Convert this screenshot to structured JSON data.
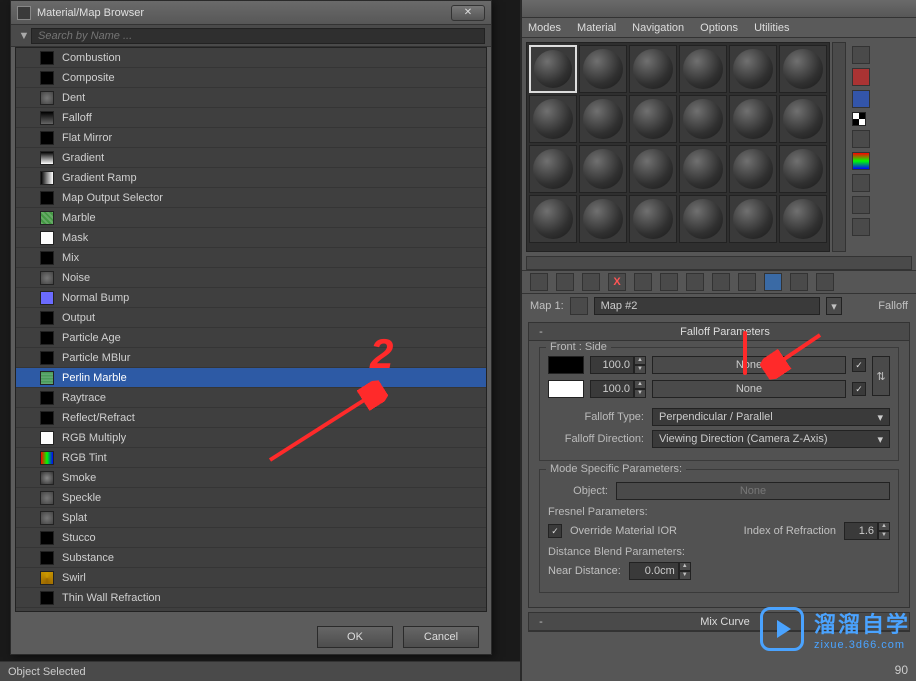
{
  "browser": {
    "title": "Material/Map Browser",
    "search_placeholder": "Search by Name ...",
    "ok_label": "OK",
    "cancel_label": "Cancel",
    "maps": [
      {
        "name": "Combustion",
        "sw": "sw-black"
      },
      {
        "name": "Composite",
        "sw": "sw-black"
      },
      {
        "name": "Dent",
        "sw": "sw-noise"
      },
      {
        "name": "Falloff",
        "sw": "sw-falloff"
      },
      {
        "name": "Flat Mirror",
        "sw": "sw-black"
      },
      {
        "name": "Gradient",
        "sw": "sw-gradient"
      },
      {
        "name": "Gradient Ramp",
        "sw": "sw-gradramp"
      },
      {
        "name": "Map Output Selector",
        "sw": "sw-black"
      },
      {
        "name": "Marble",
        "sw": "sw-marble"
      },
      {
        "name": "Mask",
        "sw": "sw-white"
      },
      {
        "name": "Mix",
        "sw": "sw-black"
      },
      {
        "name": "Noise",
        "sw": "sw-noise"
      },
      {
        "name": "Normal Bump",
        "sw": "sw-normal"
      },
      {
        "name": "Output",
        "sw": "sw-black"
      },
      {
        "name": "Particle Age",
        "sw": "sw-black"
      },
      {
        "name": "Particle MBlur",
        "sw": "sw-black"
      },
      {
        "name": "Perlin Marble",
        "sw": "sw-perlin",
        "selected": true
      },
      {
        "name": "Raytrace",
        "sw": "sw-black"
      },
      {
        "name": "Reflect/Refract",
        "sw": "sw-black"
      },
      {
        "name": "RGB Multiply",
        "sw": "sw-white"
      },
      {
        "name": "RGB Tint",
        "sw": "sw-rgb"
      },
      {
        "name": "Smoke",
        "sw": "sw-smoke"
      },
      {
        "name": "Speckle",
        "sw": "sw-noise"
      },
      {
        "name": "Splat",
        "sw": "sw-noise"
      },
      {
        "name": "Stucco",
        "sw": "sw-black"
      },
      {
        "name": "Substance",
        "sw": "sw-black"
      },
      {
        "name": "Swirl",
        "sw": "sw-swirl"
      },
      {
        "name": "Thin Wall Refraction",
        "sw": "sw-black"
      }
    ]
  },
  "editor": {
    "menu": [
      "Modes",
      "Material",
      "Navigation",
      "Options",
      "Utilities"
    ],
    "map_label": "Map 1:",
    "map_name": "Map #2",
    "map_type": "Falloff",
    "rollouts": {
      "falloff_params": {
        "title": "Falloff Parameters",
        "front_side_label": "Front : Side",
        "val1": "100.0",
        "val2": "100.0",
        "none_label": "None",
        "falloff_type_label": "Falloff Type:",
        "falloff_type_value": "Perpendicular / Parallel",
        "falloff_dir_label": "Falloff Direction:",
        "falloff_dir_value": "Viewing Direction (Camera Z-Axis)"
      },
      "mode_specific": {
        "title": "Mode Specific Parameters:",
        "object_label": "Object:",
        "object_value": "None",
        "fresnel_label": "Fresnel Parameters:",
        "override_label": "Override Material IOR",
        "ior_label": "Index of Refraction",
        "ior_value": "1.6",
        "distance_label": "Distance Blend Parameters:",
        "near_label": "Near Distance:",
        "near_value": "0.0cm"
      },
      "mix_curve": {
        "title": "Mix Curve"
      }
    }
  },
  "status": {
    "text": "Object Selected"
  },
  "annotations": {
    "number": "2"
  },
  "watermark": {
    "cn": "溜溜自学",
    "en": "zixue.3d66.com"
  },
  "page_number": "90"
}
